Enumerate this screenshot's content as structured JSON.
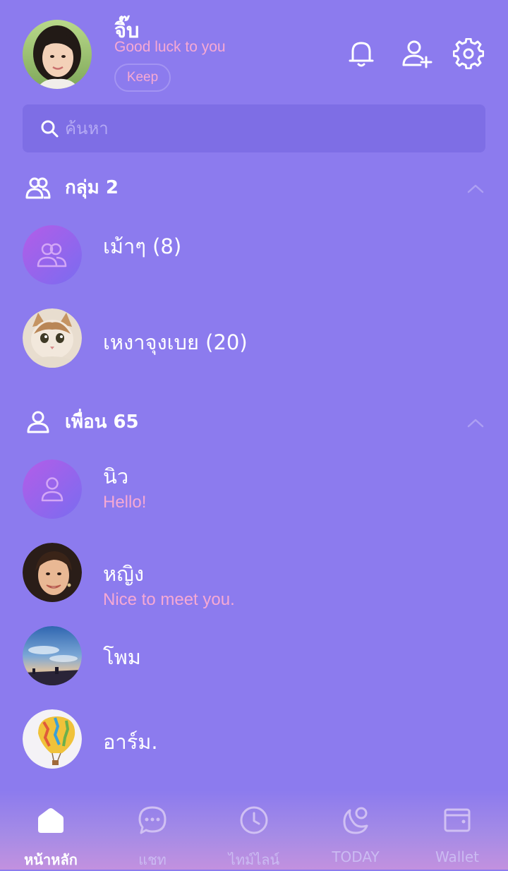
{
  "header": {
    "profile_name": "จิ๊บ",
    "profile_status": "Good luck to you",
    "keep_label": "Keep"
  },
  "search": {
    "placeholder": "ค้นหา"
  },
  "groups_section": {
    "title": "กลุ่ม 2",
    "items": [
      {
        "name": "เม้าๆ (8)"
      },
      {
        "name": "เหงาจุงเบย (20)"
      }
    ]
  },
  "friends_section": {
    "title": "เพื่อน 65",
    "items": [
      {
        "name": "นิว",
        "status": "Hello!"
      },
      {
        "name": "หญิง",
        "status": "Nice to meet you."
      },
      {
        "name": "โพม"
      },
      {
        "name": "อาร์ม."
      }
    ]
  },
  "bottom_nav": {
    "tabs": [
      {
        "label": "หน้าหลัก",
        "icon": "home-icon"
      },
      {
        "label": "แชท",
        "icon": "chat-icon"
      },
      {
        "label": "ไทม์ไลน์",
        "icon": "clock-icon"
      },
      {
        "label": "TODAY",
        "icon": "today-icon"
      },
      {
        "label": "Wallet",
        "icon": "wallet-icon"
      }
    ]
  },
  "colors": {
    "background": "#8c7bee",
    "accent_pink": "#f6a9d4",
    "search_background": "#7e6ee5"
  }
}
